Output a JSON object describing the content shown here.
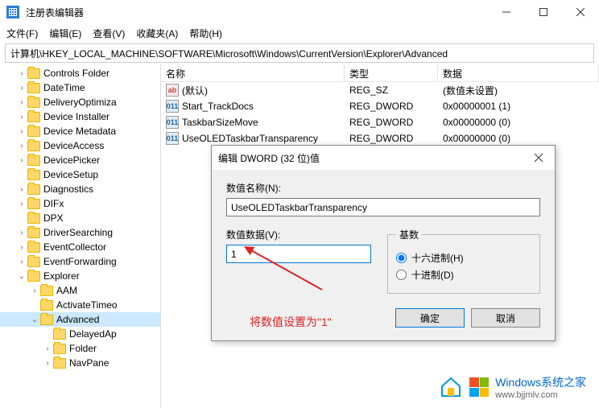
{
  "title": "注册表编辑器",
  "menu": {
    "file": "文件(F)",
    "edit": "编辑(E)",
    "view": "查看(V)",
    "fav": "收藏夹(A)",
    "help": "帮助(H)"
  },
  "address": "计算机\\HKEY_LOCAL_MACHINE\\SOFTWARE\\Microsoft\\Windows\\CurrentVersion\\Explorer\\Advanced",
  "headers": {
    "name": "名称",
    "type": "类型",
    "data": "数据"
  },
  "tree": [
    {
      "label": "Controls Folder",
      "level": 1,
      "tw": ">"
    },
    {
      "label": "DateTime",
      "level": 1,
      "tw": ">"
    },
    {
      "label": "DeliveryOptimiza",
      "level": 1,
      "tw": ">"
    },
    {
      "label": "Device Installer",
      "level": 1,
      "tw": ">"
    },
    {
      "label": "Device Metadata",
      "level": 1,
      "tw": ">"
    },
    {
      "label": "DeviceAccess",
      "level": 1,
      "tw": ">"
    },
    {
      "label": "DevicePicker",
      "level": 1,
      "tw": ">"
    },
    {
      "label": "DeviceSetup",
      "level": 1,
      "tw": ""
    },
    {
      "label": "Diagnostics",
      "level": 1,
      "tw": ">"
    },
    {
      "label": "DIFx",
      "level": 1,
      "tw": ">"
    },
    {
      "label": "DPX",
      "level": 1,
      "tw": ""
    },
    {
      "label": "DriverSearching",
      "level": 1,
      "tw": ">"
    },
    {
      "label": "EventCollector",
      "level": 1,
      "tw": ">"
    },
    {
      "label": "EventForwarding",
      "level": 1,
      "tw": ">"
    },
    {
      "label": "Explorer",
      "level": 1,
      "tw": "v"
    },
    {
      "label": "AAM",
      "level": 2,
      "tw": ">"
    },
    {
      "label": "ActivateTimeo",
      "level": 2,
      "tw": ""
    },
    {
      "label": "Advanced",
      "level": 2,
      "tw": "v",
      "selected": true
    },
    {
      "label": "DelayedAp",
      "level": 3,
      "tw": ""
    },
    {
      "label": "Folder",
      "level": 3,
      "tw": ">"
    },
    {
      "label": "NavPane",
      "level": 3,
      "tw": ">"
    }
  ],
  "values": [
    {
      "name": "(默认)",
      "type": "REG_SZ",
      "data": "(数值未设置)",
      "kind": "str"
    },
    {
      "name": "Start_TrackDocs",
      "type": "REG_DWORD",
      "data": "0x00000001 (1)",
      "kind": "dw"
    },
    {
      "name": "TaskbarSizeMove",
      "type": "REG_DWORD",
      "data": "0x00000000 (0)",
      "kind": "dw"
    },
    {
      "name": "UseOLEDTaskbarTransparency",
      "type": "REG_DWORD",
      "data": "0x00000000 (0)",
      "kind": "dw"
    }
  ],
  "dialog": {
    "title": "编辑 DWORD (32 位)值",
    "name_label": "数值名称(N):",
    "name_value": "UseOLEDTaskbarTransparency",
    "data_label": "数值数据(V):",
    "data_value": "1",
    "base_label": "基数",
    "hex": "十六进制(H)",
    "dec": "十进制(D)",
    "ok": "确定",
    "cancel": "取消"
  },
  "annotation": "将数值设置为\"1\"",
  "watermark": {
    "brand": "Windows系统之家",
    "url": "www.bjjmlv.com"
  }
}
